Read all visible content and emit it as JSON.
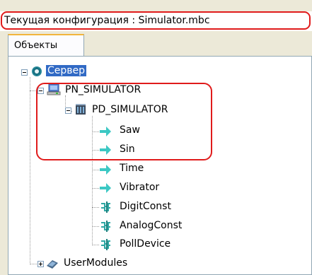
{
  "title_bar": {
    "text": "Текущая конфигурация : Simulator.mbc"
  },
  "tabs": [
    {
      "label": "Объекты"
    }
  ],
  "tree": {
    "root": {
      "label": "Сервер",
      "icon": "server-icon"
    },
    "pn": {
      "label": "PN_SIMULATOR",
      "icon": "computer-icon"
    },
    "pd": {
      "label": "PD_SIMULATOR",
      "icon": "device-icon"
    },
    "items": [
      {
        "label": "Saw",
        "icon": "signal-arrow-icon"
      },
      {
        "label": "Sin",
        "icon": "signal-arrow-icon"
      },
      {
        "label": "Time",
        "icon": "signal-arrow-icon"
      },
      {
        "label": "Vibrator",
        "icon": "signal-arrow-icon"
      },
      {
        "label": "DigitConst",
        "icon": "constant-icon"
      },
      {
        "label": "AnalogConst",
        "icon": "constant-icon"
      },
      {
        "label": "PollDevice",
        "icon": "constant-icon"
      }
    ],
    "user_modules": {
      "label": "UserModules",
      "icon": "modules-icon"
    }
  },
  "colors": {
    "highlight": "#e01b1b",
    "selection": "#316ac5",
    "arrow": "#3cc8c4"
  }
}
